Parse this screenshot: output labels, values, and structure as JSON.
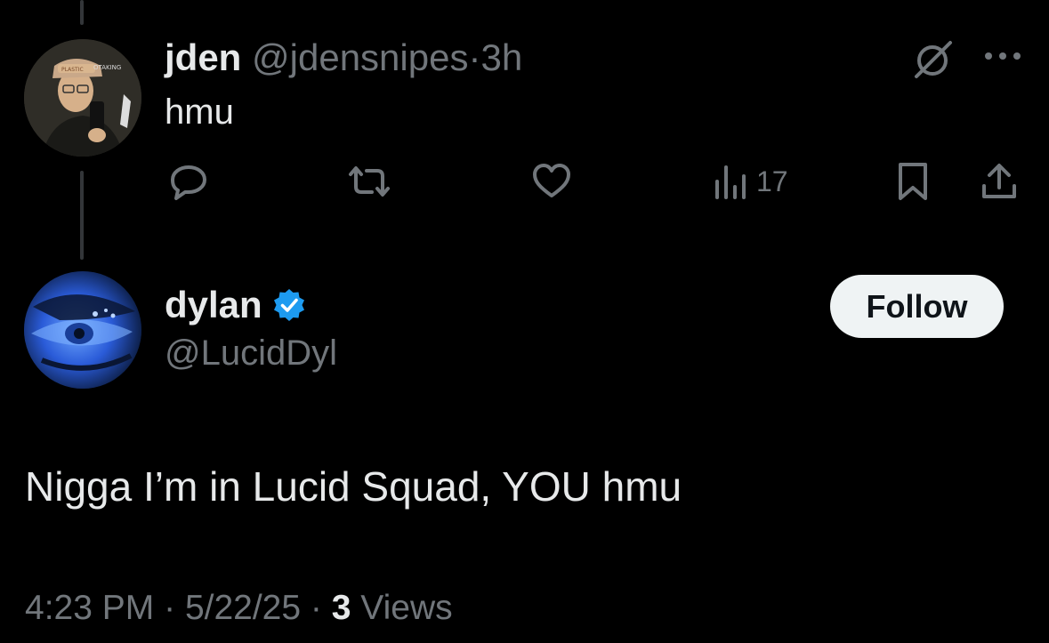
{
  "tweet": {
    "author_name": "jden",
    "author_handle": "@jdensnipes",
    "separator": "·",
    "time": "3h",
    "text": "hmu",
    "views_count": "17"
  },
  "reply": {
    "author_name": "dylan",
    "author_handle": "@LucidDyl",
    "follow_label": "Follow",
    "text": "Nigga I’m in Lucid Squad, YOU hmu",
    "time": "4:23 PM",
    "date": "5/22/25",
    "separator": "·",
    "views_count": "3",
    "views_label": "Views"
  },
  "icons": {
    "reply": "reply-icon",
    "repost": "repost-icon",
    "like": "heart-icon",
    "views": "views-icon",
    "bookmark": "bookmark-icon",
    "share": "share-icon",
    "grok": "grok-icon",
    "more": "more-icon",
    "verified": "verified-badge-icon"
  },
  "colors": {
    "background": "#000000",
    "text": "#e7e9ea",
    "muted": "#71767b",
    "verified": "#1d9bf0",
    "follow_bg": "#eff3f4"
  }
}
